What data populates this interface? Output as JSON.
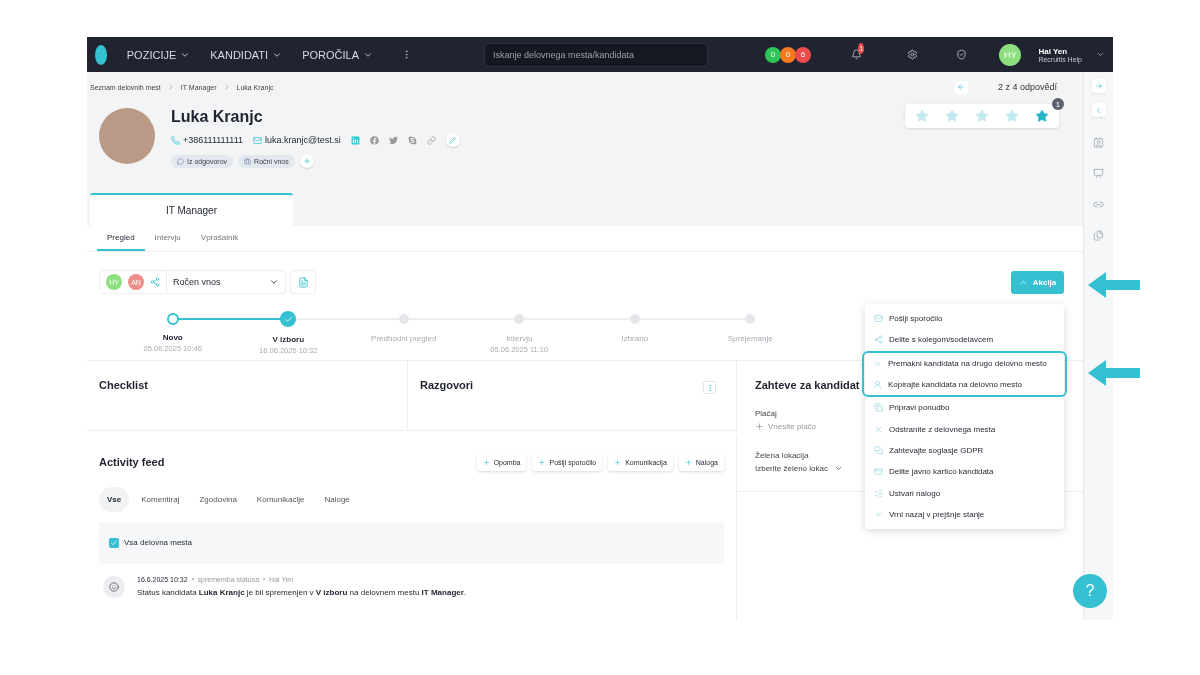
{
  "nav": {
    "menu": [
      {
        "label": "POZICIJE"
      },
      {
        "label": "KANDIDATI"
      },
      {
        "label": "POROČILA"
      }
    ],
    "search": {
      "placeholder": "Iskanje delovnega mesta/kandidata"
    },
    "counters": [
      {
        "value": "0",
        "color": "#2ec45a"
      },
      {
        "value": "0",
        "color": "#f47a1f"
      },
      {
        "value": "6",
        "color": "#ea4b4b"
      }
    ],
    "notifications": "1",
    "user": {
      "initials": "HY",
      "name": "Hai Yen",
      "role": "Recruitis Help"
    }
  },
  "breadcrumb": [
    "Seznam delovnih mest",
    "IT Manager",
    "Luka Kranjc"
  ],
  "pager": "2 z 4 odpovědí",
  "candidate": {
    "name": "Luka Kranjc",
    "phone": "+386111111111",
    "email": "luka.kranjc@test.si",
    "tags": [
      {
        "label": "Iz odgovorov",
        "kind": "message"
      },
      {
        "label": "Ročni vnos",
        "kind": "briefcase"
      }
    ]
  },
  "rating": {
    "count": "1",
    "stars": [
      {
        "selected": false
      },
      {
        "selected": false
      },
      {
        "selected": false
      },
      {
        "selected": false
      },
      {
        "selected": true
      }
    ]
  },
  "job_tabs": [
    {
      "label": "IT Manager",
      "selected": true
    }
  ],
  "subtabs": [
    {
      "label": "Pregled",
      "selected": true
    },
    {
      "label": "Intervju",
      "selected": false
    },
    {
      "label": "Vprašalnik",
      "selected": false
    }
  ],
  "toolbar": {
    "assignees": [
      {
        "initials": "HY",
        "color": "#8ee07f"
      },
      {
        "initials": "AN",
        "color": "#ec8f8a"
      }
    ],
    "source": "Ročen vnos",
    "action": "Akcija"
  },
  "steps": [
    {
      "label": "Novo",
      "date": "05.06.2025 10:46",
      "kind": "done"
    },
    {
      "label": "V izboru",
      "date": "16.06.2025 10:32",
      "kind": "current"
    },
    {
      "label": "Predhodni pregled",
      "kind": "pending"
    },
    {
      "label": "Intervju",
      "date": "05.06.2025 11:10",
      "kind": "pending"
    },
    {
      "label": "Izbrano",
      "kind": "pending"
    },
    {
      "label": "Sprejemanje",
      "kind": "pending"
    }
  ],
  "panels": {
    "checklist": "Checklist",
    "conversations": "Razgovori",
    "requirements": {
      "title": "Zahteve za kandidat",
      "salary_label": "Plačaj",
      "salary_placeholder": "Vnesite plačo",
      "location_label": "Želena lokacija",
      "location_placeholder": "Izberite želeno lokac"
    }
  },
  "activity": {
    "title": "Activity feed",
    "buttons": [
      "Opomba",
      "Pošlji sporočilo",
      "Komunikacija",
      "Naloga"
    ],
    "filters": [
      {
        "label": "Vse",
        "selected": true
      },
      {
        "label": "Komentiraj",
        "selected": false
      },
      {
        "label": "Zgodovina",
        "selected": false
      },
      {
        "label": "Komunikacije",
        "selected": false
      },
      {
        "label": "Naloge",
        "selected": false
      }
    ],
    "all_jobs": {
      "label": "Vsa delovna mesta",
      "checked": true
    },
    "entries": [
      {
        "date": "16.6.2025 10:32",
        "type": "sprememba statusa",
        "author": "Hai Yen",
        "text": "Status kandidata **Luka Kranjc** je bil spremenjen v **V izboru** na delovnem mestu **IT Manager**."
      }
    ]
  },
  "menu": [
    {
      "label": "Pošlji sporočilo",
      "kind": "mail",
      "highlighted": false
    },
    {
      "label": "Delite s kolegom/sodelavcem",
      "kind": "share",
      "highlighted": false
    },
    {
      "label": "Premakni kandidata na drugo delovno mesto",
      "kind": "move",
      "highlighted": true
    },
    {
      "label": "Kopirajte kandidata na delovno mesto",
      "kind": "user",
      "highlighted": true
    },
    {
      "label": "Pripravi ponudbo",
      "kind": "copy",
      "highlighted": false
    },
    {
      "label": "Odstranite z delovnega mesta",
      "kind": "remove",
      "highlighted": false
    },
    {
      "label": "Zahtevajte soglasje GDPR",
      "kind": "chat",
      "highlighted": false
    },
    {
      "label": "Delite javno kartico kandidata",
      "kind": "card",
      "highlighted": false
    },
    {
      "label": "Ustvari nalogo",
      "kind": "list",
      "highlighted": false
    },
    {
      "label": "Vrni nazaj v prejšnje stanje",
      "kind": "back",
      "highlighted": false
    }
  ],
  "help": "?"
}
